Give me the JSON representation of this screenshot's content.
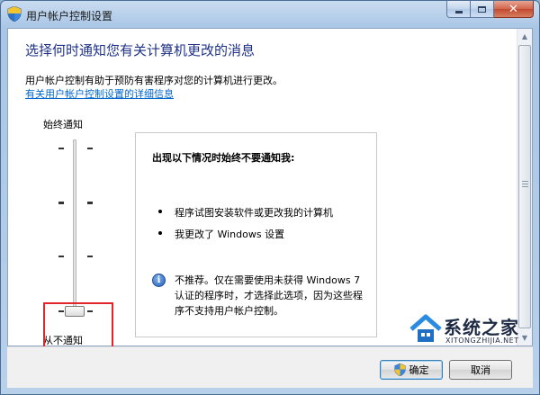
{
  "window": {
    "title": "用户帐户控制设置"
  },
  "main": {
    "heading": "选择何时通知您有关计算机更改的消息",
    "description": "用户帐户控制有助于预防有害程序对您的计算机进行更改。",
    "link": "有关用户帐户控制设置的详细信息"
  },
  "slider": {
    "top_label": "始终通知",
    "bottom_label": "从不通知",
    "levels": 4,
    "selected_level": 1
  },
  "info": {
    "title": "出现以下情况时始终不要通知我:",
    "bullets": [
      "程序试图安装软件或更改我的计算机",
      "我更改了 Windows 设置"
    ],
    "note": "不推荐。仅在需要使用未获得 Windows 7 认证的程序时，才选择此选项，因为这些程序不支持用户帐户控制。"
  },
  "buttons": {
    "ok": "确定",
    "cancel": "取消"
  },
  "watermark": {
    "text": "系统之家",
    "sub": "XITONGZHIJIA.NET"
  },
  "colors": {
    "heading": "#1e3287",
    "link": "#0066cc",
    "highlight": "#e0262b"
  }
}
